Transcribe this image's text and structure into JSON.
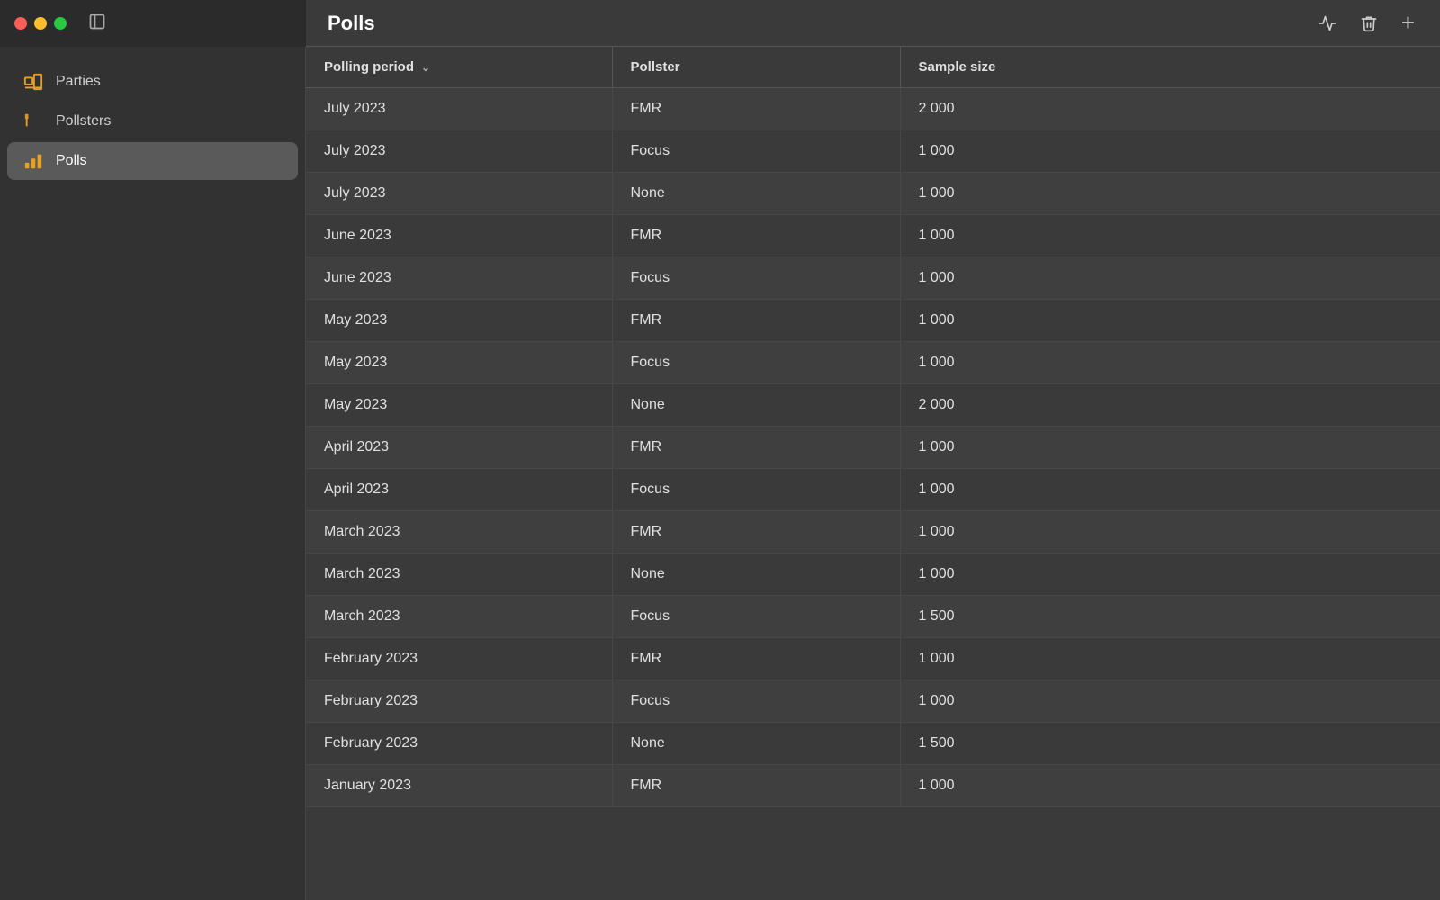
{
  "app": {
    "title": "Polls"
  },
  "sidebar": {
    "items": [
      {
        "id": "parties",
        "label": "Parties",
        "icon": "parties-icon"
      },
      {
        "id": "pollsters",
        "label": "Pollsters",
        "icon": "pollsters-icon"
      },
      {
        "id": "polls",
        "label": "Polls",
        "icon": "polls-icon",
        "active": true
      }
    ]
  },
  "toolbar": {
    "chart_label": "📈",
    "delete_label": "🗑",
    "add_label": "+"
  },
  "table": {
    "columns": [
      {
        "id": "polling_period",
        "label": "Polling period",
        "sortable": true
      },
      {
        "id": "pollster",
        "label": "Pollster",
        "sortable": false
      },
      {
        "id": "sample_size",
        "label": "Sample size",
        "sortable": false
      }
    ],
    "rows": [
      {
        "polling_period": "July 2023",
        "pollster": "FMR",
        "sample_size": "2 000"
      },
      {
        "polling_period": "July 2023",
        "pollster": "Focus",
        "sample_size": "1 000"
      },
      {
        "polling_period": "July 2023",
        "pollster": "None",
        "sample_size": "1 000"
      },
      {
        "polling_period": "June 2023",
        "pollster": "FMR",
        "sample_size": "1 000"
      },
      {
        "polling_period": "June 2023",
        "pollster": "Focus",
        "sample_size": "1 000"
      },
      {
        "polling_period": "May 2023",
        "pollster": "FMR",
        "sample_size": "1 000"
      },
      {
        "polling_period": "May 2023",
        "pollster": "Focus",
        "sample_size": "1 000"
      },
      {
        "polling_period": "May 2023",
        "pollster": "None",
        "sample_size": "2 000"
      },
      {
        "polling_period": "April 2023",
        "pollster": "FMR",
        "sample_size": "1 000"
      },
      {
        "polling_period": "April 2023",
        "pollster": "Focus",
        "sample_size": "1 000"
      },
      {
        "polling_period": "March 2023",
        "pollster": "FMR",
        "sample_size": "1 000"
      },
      {
        "polling_period": "March 2023",
        "pollster": "None",
        "sample_size": "1 000"
      },
      {
        "polling_period": "March 2023",
        "pollster": "Focus",
        "sample_size": "1 500"
      },
      {
        "polling_period": "February 2023",
        "pollster": "FMR",
        "sample_size": "1 000"
      },
      {
        "polling_period": "February 2023",
        "pollster": "Focus",
        "sample_size": "1 000"
      },
      {
        "polling_period": "February 2023",
        "pollster": "None",
        "sample_size": "1 500"
      },
      {
        "polling_period": "January 2023",
        "pollster": "FMR",
        "sample_size": "1 000"
      }
    ]
  }
}
